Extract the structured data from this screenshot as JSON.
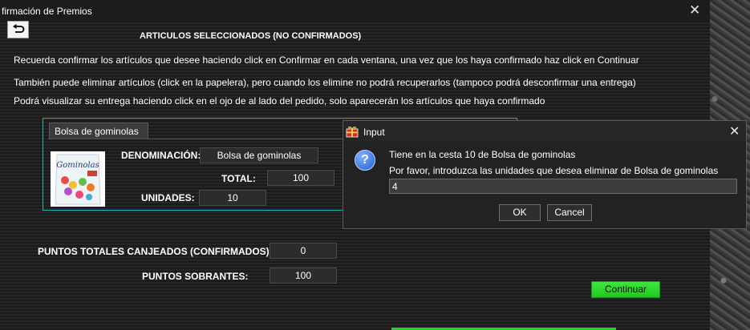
{
  "window": {
    "title": "firmación de Premios"
  },
  "heading": "ARTICULOS SELECCIONADOS (NO CONFIRMADOS)",
  "instructions": [
    "Recuerda confirmar los artículos que desee haciendo click en Confirmar en cada ventana, una vez que los haya confirmado haz click en Continuar",
    "También puede eliminar artículos (click en la papelera), pero cuando los elimine no podrá recuperarlos (tampoco podrá desconfirmar una entrega)",
    "Podrá visualizar su entrega haciendo click en el ojo de al lado del pedido, solo aparecerán los artículos que haya confirmado"
  ],
  "product": {
    "tab_label": "Bolsa de gominolas",
    "image_text": "Gominolas",
    "denominacion_label": "DENOMINACIÓN:",
    "denominacion_value": "Bolsa de gominolas",
    "total_label": "TOTAL:",
    "total_value": "100",
    "unidades_label": "UNIDADES:",
    "unidades_value": "10"
  },
  "totals": {
    "canjeados_label": "PUNTOS TOTALES CANJEADOS (CONFIRMADOS):",
    "canjeados_value": "0",
    "sobrantes_label": "PUNTOS SOBRANTES:",
    "sobrantes_value": "100"
  },
  "continuar_label": "Continuar",
  "dialog": {
    "title": "Input",
    "line1": "Tiene en la cesta 10 de Bolsa de gominolas",
    "line2": "Por favor, introduzca las unidades que desea eliminar de Bolsa de gominolas",
    "input_value": "4",
    "ok_label": "OK",
    "cancel_label": "Cancel"
  },
  "colors": {
    "accent_green": "#23d323",
    "panel_border": "#21b3b3",
    "question_blue": "#1f5fd0"
  }
}
